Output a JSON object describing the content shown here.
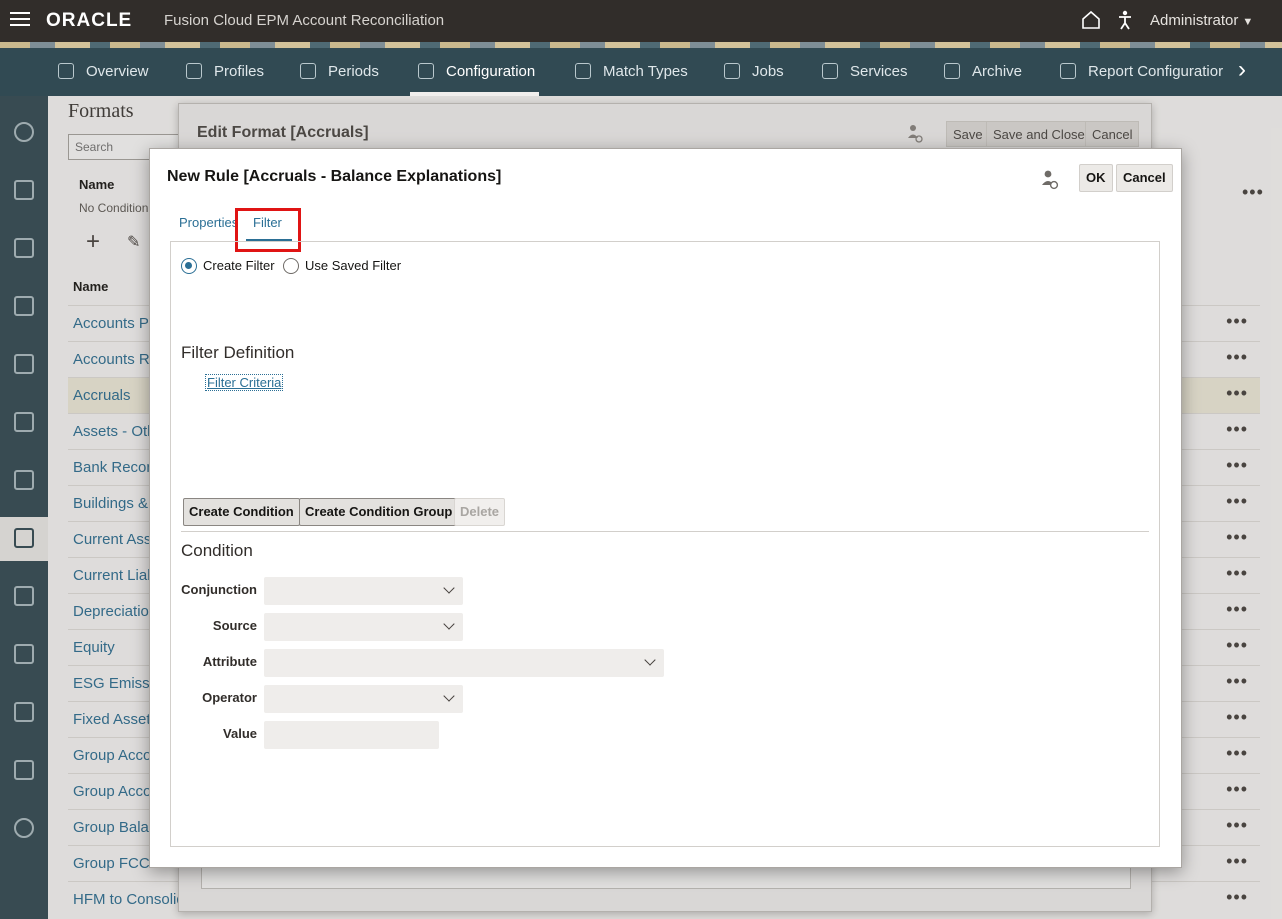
{
  "topbar": {
    "logo": "ORACLE",
    "app_title": "Fusion Cloud EPM Account Reconciliation",
    "user": "Administrator"
  },
  "nav": {
    "items": [
      {
        "label": "Overview",
        "icon": "overview-icon"
      },
      {
        "label": "Profiles",
        "icon": "profiles-icon"
      },
      {
        "label": "Periods",
        "icon": "periods-icon"
      },
      {
        "label": "Configuration",
        "icon": "configuration-icon",
        "active": true
      },
      {
        "label": "Match Types",
        "icon": "match-types-icon"
      },
      {
        "label": "Jobs",
        "icon": "jobs-icon"
      },
      {
        "label": "Services",
        "icon": "services-icon"
      },
      {
        "label": "Archive",
        "icon": "archive-icon"
      },
      {
        "label": "Report Configuratior",
        "icon": "report-configuration-icon"
      }
    ]
  },
  "list_page": {
    "title": "Formats",
    "search_placeholder": "Search",
    "name_header": "Name",
    "no_condition": "No Condition",
    "column_name": "Name",
    "rows": [
      "Accounts Pa",
      "Accounts Re",
      "Accruals",
      "Assets - Oth",
      "Bank Recon",
      "Buildings &",
      "Current Asse",
      "Current Liab",
      "Depreciation",
      "Equity",
      "ESG Emissio",
      "Fixed Assets",
      "Group Acco",
      "Group Acco",
      "Group Balar",
      "Group FCC",
      "HFM to Consolid"
    ],
    "selected_row": 2,
    "more_glyph": "•••"
  },
  "edit_dialog": {
    "title": "Edit Format [Accruals]",
    "save": "Save",
    "save_close": "Save and Close",
    "cancel": "Cancel"
  },
  "rule_dialog": {
    "title": "New Rule [Accruals - Balance Explanations]",
    "ok": "OK",
    "cancel": "Cancel",
    "tabs": [
      "Properties",
      "Filter"
    ],
    "active_tab": "Filter",
    "radio_create": "Create Filter",
    "radio_saved": "Use Saved Filter",
    "filter_definition": "Filter Definition",
    "filter_criteria": "Filter Criteria",
    "create_condition": "Create Condition",
    "create_condition_group": "Create Condition Group",
    "delete": "Delete",
    "condition_heading": "Condition",
    "fields": {
      "conjunction": "Conjunction",
      "source": "Source",
      "attribute": "Attribute",
      "operator": "Operator",
      "value": "Value"
    }
  },
  "colors": {
    "topbar": "#312d2a",
    "navbar": "#314a53",
    "link": "#2b6f95",
    "highlight_box": "#e01414"
  }
}
